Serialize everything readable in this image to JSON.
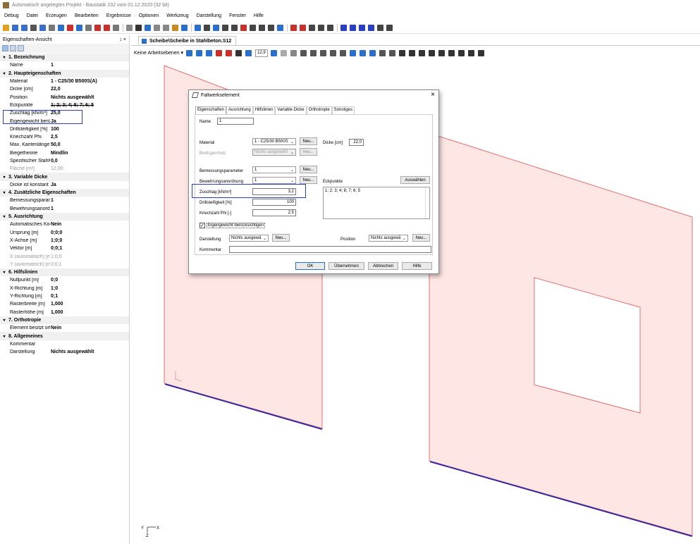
{
  "window": {
    "title": "Automatisch angelegtes Projekt - Baustatik 232 vom 01.12.2020 (32 bit)"
  },
  "menu": [
    "Debug",
    "Datei",
    "Erzeugen",
    "Bearbeiten",
    "Ergebnisse",
    "Optionen",
    "Werkzeug",
    "Darstellung",
    "Fenster",
    "Hilfe"
  ],
  "properties_panel": {
    "title": "Eigenschaften-Ansicht",
    "pin": "↕ ×",
    "sections": [
      {
        "title": "1. Bezeichnung",
        "rows": [
          {
            "k": "Name",
            "v": "1"
          }
        ]
      },
      {
        "title": "2. Haupteigenschaften",
        "rows": [
          {
            "k": "Material",
            "v": "1 - C25/30 B500S(A)"
          },
          {
            "k": "Dicke [cm]",
            "v": "22,0"
          },
          {
            "k": "Position",
            "v": "Nichts ausgewählt"
          },
          {
            "k": "Eckpunkte",
            "v": "1; 2; 3; 4; 8; 7; 6; 5"
          },
          {
            "k": "Zuschlag [kN/m³]",
            "v": "25,0"
          },
          {
            "k": "Eigengewicht berückst",
            "v": "Ja"
          },
          {
            "k": "Drillsteifigkeit [%]",
            "v": "100"
          },
          {
            "k": "Kriechzahl Phi",
            "v": "2,5"
          },
          {
            "k": "Max. Kantenlänge der",
            "v": "50,0"
          },
          {
            "k": "Biegetheorie",
            "v": "Mindlin"
          },
          {
            "k": "Spezifischer Stahlverb",
            "v": "0,0"
          },
          {
            "k": "Fläche [m²]",
            "v": "12,00",
            "dim": true
          }
        ]
      },
      {
        "title": "3. Variable Dicke",
        "rows": [
          {
            "k": "Dicke ist konstant",
            "v": "Ja"
          }
        ]
      },
      {
        "title": "4. Zusätzliche Eigenschaften",
        "rows": [
          {
            "k": "Bemessungsparamete",
            "v": "1"
          },
          {
            "k": "Bewehrungsanordnur",
            "v": "1"
          }
        ]
      },
      {
        "title": "5. Ausrichtung",
        "rows": [
          {
            "k": "Automatisches Koord",
            "v": "Nein"
          },
          {
            "k": "Ursprung [m]",
            "v": "0;0;0"
          },
          {
            "k": "X-Achse [m]",
            "v": "1;0;0"
          },
          {
            "k": "Vektor [m]",
            "v": "0;0;1"
          },
          {
            "k": "X (automatisch) [m]",
            "v": "1;0;0",
            "dim": true
          },
          {
            "k": "Y (automatisch) [m]",
            "v": "0;0;1",
            "dim": true
          }
        ]
      },
      {
        "title": "6. Hilfslinien",
        "rows": [
          {
            "k": "Nullpunkt [m]",
            "v": "0;0"
          },
          {
            "k": "X-Richtung [m]",
            "v": "1;0"
          },
          {
            "k": "Y-Richtung [m]",
            "v": "0;1"
          },
          {
            "k": "Rasterbreite [m]",
            "v": "1,000"
          },
          {
            "k": "Rasterhöhe [m]",
            "v": "1,000"
          }
        ]
      },
      {
        "title": "7. Orthotropie",
        "rows": [
          {
            "k": "Element besitzt orthot",
            "v": "Nein"
          }
        ]
      },
      {
        "title": "8. Allgemeines",
        "rows": [
          {
            "k": "Kommentar",
            "v": ""
          },
          {
            "k": "Darstellung",
            "v": "Nichts ausgewählt"
          }
        ]
      }
    ]
  },
  "document_tab": {
    "label": "Scheibe\\Scheibe in Stahlbeton.S12"
  },
  "viewtoolbar": {
    "workspace": "Keine Arbeitsebenen ▾",
    "zoom": "12,9"
  },
  "axes": {
    "x": "X",
    "y": "Y",
    "z": "Z"
  },
  "dialog": {
    "title": "Faltwerkselement",
    "close": "×",
    "tabs": [
      "Eigenschaften",
      "Ausrichtung",
      "Hilfslinien",
      "Variable Dicke",
      "Orthotropie",
      "Sonstiges"
    ],
    "name_label": "Name",
    "name_value": "1",
    "material_label": "Material",
    "material_value": "1 - C25/30 B500S",
    "dicke_label": "Dicke [cm]",
    "dicke_value": "22,0",
    "brett_label": "Brettsperrholz",
    "brett_value": "Nichts ausgewähl",
    "bemessung_label": "Bemessungsparameter",
    "bemessung_value": "1",
    "bewehrung_label": "Bewehrungsanordnung",
    "bewehrung_value": "1",
    "eckpunkte_label": "Eckpunkte",
    "eckpunkte_value": "1; 2; 3; 4; 8; 7; 6; 5",
    "auswaehlen": "Auswählen",
    "zuschlag_label": "Zuschlag [kN/m³]",
    "zuschlag_value": "3,2",
    "drill_label": "Drillsteifigkeit [%]",
    "drill_value": "100",
    "kriech_label": "Kriechzahl Phi [-]",
    "kriech_value": "2.5",
    "eigengewicht_label": "Eigengewicht berücksichtigen",
    "eigengewicht_checked": "✓",
    "darstellung_label": "Darstellung",
    "darstellung_value": "Nichts ausgewä",
    "position_label": "Position",
    "position_value": "Nichts ausgewä",
    "kommentar_label": "Kommentar",
    "neu": "Neu...",
    "ok": "OK",
    "uebernehmen": "Übernehmen",
    "abbrechen": "Abbrechen",
    "hilfe": "Hilfe"
  },
  "colors": {
    "plate_fill": "#fde6e4",
    "plate_edge": "#e07070",
    "base_line": "#3a2aa0",
    "highlight": "#2a3ec2"
  }
}
